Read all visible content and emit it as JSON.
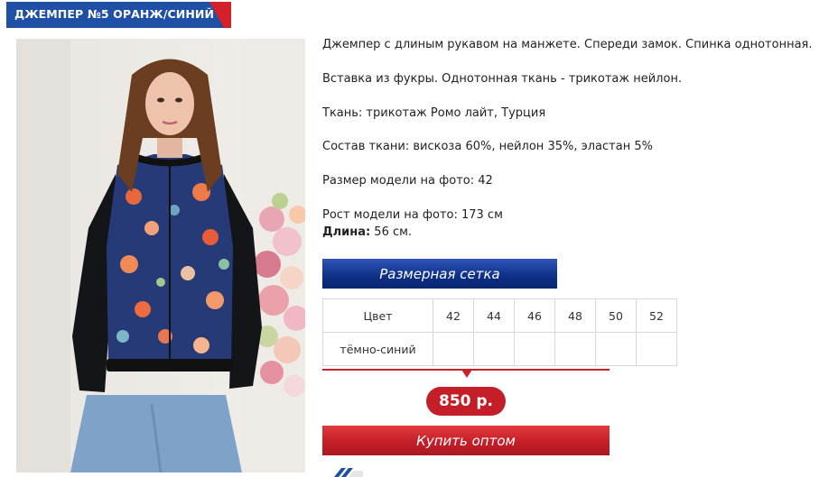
{
  "title": "ДЖЕМПЕР №5 ОРАНЖ/СИНИЙ",
  "colors": {
    "banner_blue": "#1f50a6",
    "accent_red": "#c41f28",
    "button_blue": "#0d2f86"
  },
  "description": {
    "line1": "Джемпер с длиным рукавом на манжете. Спереди замок. Спинка однотонная.",
    "line2": "Вставка из фукры. Однотонная ткань - трикотаж нейлон.",
    "line3": "Ткань: трикотаж Ромо лайт, Турция",
    "line4": "Состав ткани: вискоза 60%, нейлон 35%, эластан 5%",
    "line5": "Размер модели на фото: 42",
    "line6": "Рост модели на фото: 173 см",
    "length_label": "Длина:",
    "length_value": " 56 см."
  },
  "size_chart_button": "Размерная сетка",
  "table": {
    "header": [
      "Цвет",
      "42",
      "44",
      "46",
      "48",
      "50",
      "52"
    ],
    "rows": [
      [
        "тёмно-синий",
        "",
        "",
        "",
        "",
        "",
        ""
      ]
    ]
  },
  "price": "850 р.",
  "buy_button": "Купить оптом"
}
